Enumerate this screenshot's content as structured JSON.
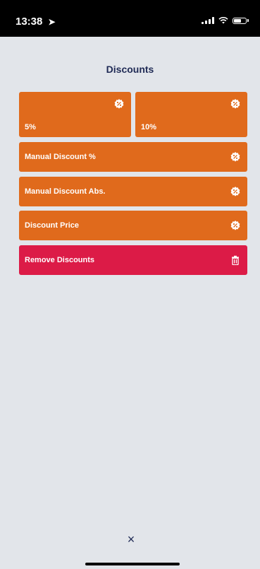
{
  "status": {
    "time": "13:38",
    "location_glyph": "➤"
  },
  "page": {
    "title": "Discounts"
  },
  "discounts": {
    "preset_1": "5%",
    "preset_2": "10%",
    "manual_percent": "Manual Discount %",
    "manual_abs": "Manual Discount Abs.",
    "discount_price": "Discount Price",
    "remove": "Remove Discounts"
  },
  "footer": {
    "close_glyph": "×"
  },
  "colors": {
    "orange": "#e06a1c",
    "red": "#dc1b47",
    "title": "#1f2a55",
    "background": "#e2e5ea"
  },
  "icons": {
    "discount": "discount-badge-icon",
    "remove": "trash-icon",
    "close": "close-icon"
  }
}
